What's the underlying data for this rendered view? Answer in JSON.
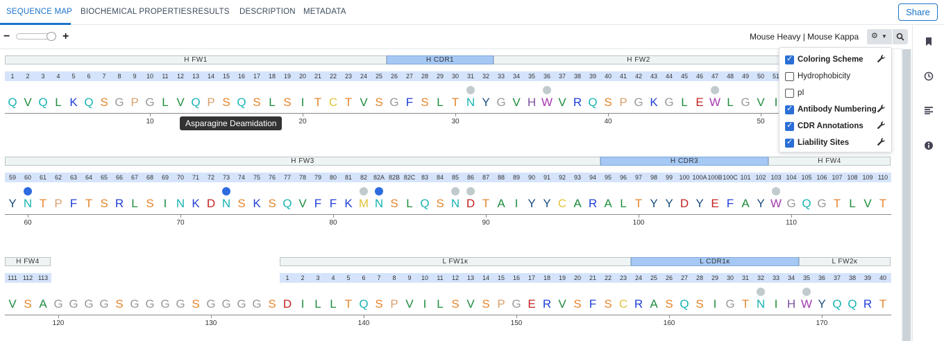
{
  "tabs": [
    {
      "label": "SEQUENCE MAP",
      "active": true
    },
    {
      "label": "BIOCHEMICAL PROPERTIES"
    },
    {
      "label": "RESULTS"
    },
    {
      "label": "DESCRIPTION"
    },
    {
      "label": "METADATA"
    }
  ],
  "share_label": "Share",
  "toolbar": {
    "zoom_out": "−",
    "zoom_in": "+",
    "zoom_level": 0.85,
    "species": "Mouse Heavy | Mouse Kappa"
  },
  "settings_menu": [
    {
      "label": "Coloring Scheme",
      "checked": true,
      "wrench": true
    },
    {
      "label": "Hydrophobicity",
      "checked": false,
      "wrench": false
    },
    {
      "label": "pI",
      "checked": false,
      "wrench": false
    },
    {
      "label": "Antibody Numbering",
      "checked": true,
      "wrench": true
    },
    {
      "label": "CDR Annotations",
      "checked": true,
      "wrench": true
    },
    {
      "label": "Liability Sites",
      "checked": true,
      "wrench": true
    }
  ],
  "tooltip": "Asparagine Deamidation",
  "aa_colors": {
    "Q": "#18b3b3",
    "V": "#1e8c3e",
    "L": "#1e8c3e",
    "I": "#1e8c3e",
    "A": "#1e8c3e",
    "K": "#1f3ed6",
    "R": "#1f3ed6",
    "S": "#e5852d",
    "T": "#e5852d",
    "G": "#999999",
    "P": "#d9a06c",
    "F": "#1f3ed6",
    "W": "#a43ab0",
    "Y": "#1b4c7a",
    "H": "#7b4fa3",
    "N": "#18b3b3",
    "E": "#c32222",
    "D": "#c32222",
    "C": "#e2c33a",
    "M": "#e2c33a"
  },
  "rows": [
    {
      "regions": [
        {
          "label": "H FW1",
          "type": "fw",
          "from": 0,
          "to": 25
        },
        {
          "label": "H CDR1",
          "type": "cdr",
          "from": 25,
          "to": 32
        },
        {
          "label": "H FW2",
          "type": "fw",
          "from": 32,
          "to": 51
        }
      ],
      "numbers": [
        "1",
        "2",
        "3",
        "4",
        "5",
        "6",
        "7",
        "8",
        "9",
        "10",
        "11",
        "12",
        "13",
        "14",
        "15",
        "16",
        "17",
        "18",
        "19",
        "20",
        "21",
        "22",
        "23",
        "24",
        "25",
        "26",
        "27",
        "28",
        "29",
        "30",
        "31",
        "32",
        "33",
        "34",
        "35",
        "36",
        "37",
        "38",
        "39",
        "40",
        "41",
        "42",
        "43",
        "44",
        "45",
        "46",
        "47",
        "48",
        "49",
        "50",
        "51"
      ],
      "sequence": "QVQLKQSGPGLVQPSQSLSITCTVSGFSLTNYGVHWVRQSPGKGLEWLGVI",
      "liability": [
        {
          "i": 30,
          "c": "grey"
        },
        {
          "i": 35,
          "c": "grey"
        },
        {
          "i": 46,
          "c": "grey"
        }
      ],
      "ticks": [
        {
          "i": 9,
          "label": "10"
        },
        {
          "i": 19,
          "label": "20"
        },
        {
          "i": 29,
          "label": "30"
        },
        {
          "i": 39,
          "label": "40"
        },
        {
          "i": 49,
          "label": "50"
        }
      ]
    },
    {
      "regions": [
        {
          "label": "H FW3",
          "type": "fw",
          "from": 0,
          "to": 39
        },
        {
          "label": "H CDR3",
          "type": "cdr",
          "from": 39,
          "to": 50
        },
        {
          "label": "H FW4",
          "type": "fw",
          "from": 50,
          "to": 58
        }
      ],
      "numbers": [
        "59",
        "60",
        "61",
        "62",
        "63",
        "64",
        "65",
        "66",
        "67",
        "68",
        "69",
        "70",
        "71",
        "72",
        "73",
        "74",
        "75",
        "76",
        "77",
        "78",
        "79",
        "80",
        "81",
        "82",
        "82A",
        "82B",
        "82C",
        "83",
        "84",
        "85",
        "86",
        "87",
        "88",
        "89",
        "90",
        "91",
        "92",
        "93",
        "94",
        "95",
        "96",
        "97",
        "98",
        "99",
        "100",
        "100A",
        "100B",
        "100C",
        "101",
        "102",
        "103",
        "104",
        "105",
        "106",
        "107",
        "108",
        "109",
        "110"
      ],
      "sequence": "YNTPFTSRLSINKDNSKSQVFFKMNSLQSNDTAIYYCARALTYYDYEFAYWGQGTLVT",
      "liability": [
        {
          "i": 1,
          "c": "blue"
        },
        {
          "i": 14,
          "c": "blue"
        },
        {
          "i": 23,
          "c": "grey"
        },
        {
          "i": 24,
          "c": "blue"
        },
        {
          "i": 29,
          "c": "grey"
        },
        {
          "i": 30,
          "c": "grey"
        },
        {
          "i": 50,
          "c": "grey"
        }
      ],
      "ticks": [
        {
          "i": 1,
          "label": "60"
        },
        {
          "i": 11,
          "label": "70"
        },
        {
          "i": 21,
          "label": "80"
        },
        {
          "i": 31,
          "label": "90"
        },
        {
          "i": 41,
          "label": "100"
        },
        {
          "i": 51,
          "label": "110"
        }
      ]
    },
    {
      "regions": [
        {
          "label": "H FW4",
          "type": "fw",
          "from": 0,
          "to": 3
        },
        {
          "label": "L FW1κ",
          "type": "fw",
          "from": 18,
          "to": 41
        },
        {
          "label": "L CDR1κ",
          "type": "cdr",
          "from": 41,
          "to": 52
        },
        {
          "label": "L FW2κ",
          "type": "fw",
          "from": 52,
          "to": 58
        }
      ],
      "numbers": [
        "111",
        "112",
        "113",
        "",
        "",
        "",
        "",
        "",
        "",
        "",
        "",
        "",
        "",
        "",
        "",
        "",
        "",
        "",
        "1",
        "2",
        "3",
        "4",
        "5",
        "6",
        "7",
        "8",
        "9",
        "10",
        "11",
        "12",
        "13",
        "14",
        "15",
        "16",
        "17",
        "18",
        "19",
        "20",
        "21",
        "22",
        "23",
        "24",
        "25",
        "26",
        "27",
        "28",
        "29",
        "30",
        "31",
        "32",
        "33",
        "34",
        "35",
        "36",
        "37",
        "38",
        "39",
        "40"
      ],
      "sequence": "VSAGGGGSGGGGSGGGGSDILLTQSPVILSVSPGERVSFSCRASQSIGTNIHWYQQRT",
      "liability": [
        {
          "i": 49,
          "c": "grey"
        },
        {
          "i": 52,
          "c": "grey"
        }
      ],
      "ticks": [
        {
          "i": 3,
          "label": "120"
        },
        {
          "i": 13,
          "label": "130"
        },
        {
          "i": 23,
          "label": "140"
        },
        {
          "i": 33,
          "label": "150"
        },
        {
          "i": 43,
          "label": "160"
        },
        {
          "i": 53,
          "label": "170"
        }
      ]
    }
  ]
}
